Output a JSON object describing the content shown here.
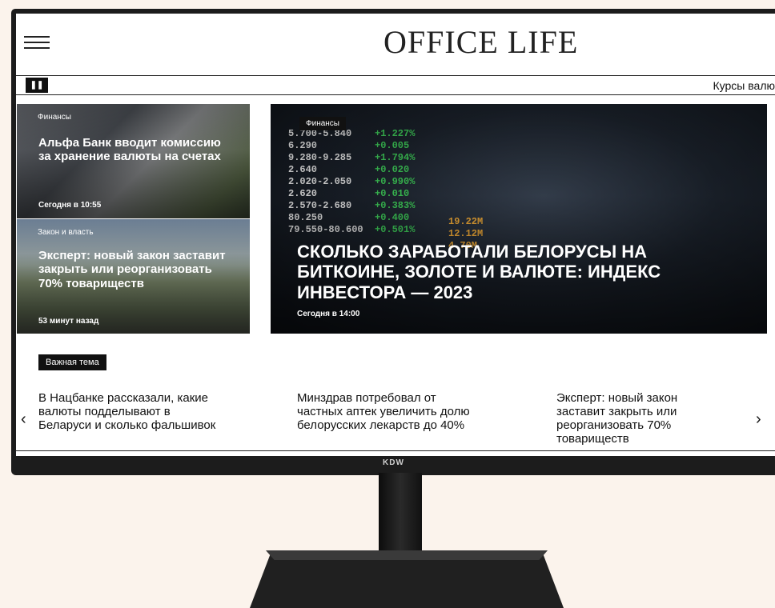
{
  "site": {
    "logo": "OFFICE LIFE",
    "ticker": "Курсы валю",
    "pause_label": "❚❚"
  },
  "cards": [
    {
      "category": "Финансы",
      "title": "Альфа Банк вводит комиссию за хранение валюты на счетах",
      "time": "Сегодня в 10:55"
    },
    {
      "category": "Закон и власть",
      "title": "Эксперт: новый закон заставит закрыть или реорганизовать 70% товариществ",
      "time": "53 минут назад"
    },
    {
      "category": "Финансы",
      "title": "СКОЛЬКО ЗАРАБОТАЛИ БЕЛОРУСЫ НА БИТКОИНЕ, ЗОЛОТЕ И ВАЛЮТЕ: ИНДЕКС ИНВЕСТОРА — 2023",
      "time": "Сегодня в 14:00"
    }
  ],
  "important": {
    "label": "Важная тема",
    "prev": "‹",
    "next": "›",
    "items": [
      "В Нацбанке рассказали, какие валюты подделывают в Беларуси и сколько фальшивок",
      "Минздрав потребовал от частных аптек увеличить долю белорусских лекарств до 40%",
      "Эксперт: новый закон заставит закрыть или реорганизовать 70% товариществ"
    ]
  },
  "monitor": {
    "brand": "KDW"
  }
}
